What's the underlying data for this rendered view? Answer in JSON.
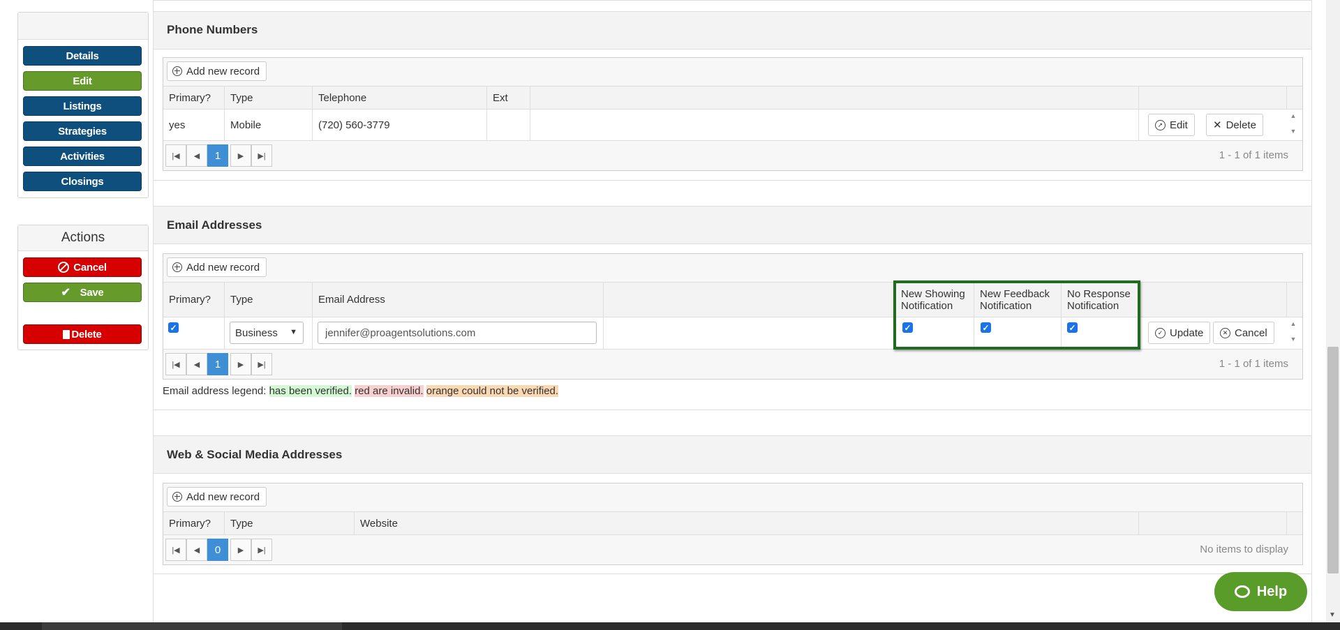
{
  "sidebar": {
    "nav": [
      {
        "label": "Details",
        "color": "#0f4f7d"
      },
      {
        "label": "Edit",
        "color": "#669a2b"
      },
      {
        "label": "Listings",
        "color": "#0f4f7d"
      },
      {
        "label": "Strategies",
        "color": "#0f4f7d"
      },
      {
        "label": "Activities",
        "color": "#0f4f7d"
      },
      {
        "label": "Closings",
        "color": "#0f4f7d"
      }
    ],
    "actions": {
      "title": "Actions",
      "cancel_label": "Cancel",
      "save_label": "Save",
      "delete_label": "Delete"
    }
  },
  "phone": {
    "title": "Phone Numbers",
    "add_label": "Add new record",
    "columns": [
      "Primary?",
      "Type",
      "Telephone",
      "Ext"
    ],
    "rows": [
      {
        "primary": "yes",
        "type": "Mobile",
        "telephone": "(720) 560-3779",
        "ext": ""
      }
    ],
    "edit_label": "Edit",
    "delete_label": "Delete",
    "page": "1",
    "pager_info": "1 - 1 of 1 items"
  },
  "email": {
    "title": "Email Addresses",
    "add_label": "Add new record",
    "columns": [
      "Primary?",
      "Type",
      "Email Address"
    ],
    "notif_columns": [
      "New Showing Notification",
      "New Feedback Notification",
      "No Response Notification"
    ],
    "notif_lines": [
      [
        "New Showing",
        "Notification"
      ],
      [
        "New Feedback",
        "Notification"
      ],
      [
        "No Response",
        "Notification"
      ]
    ],
    "row": {
      "primary_checked": true,
      "type_value": "Business",
      "email_value": "jennifer@proagentsolutions.com",
      "showing_checked": true,
      "feedback_checked": true,
      "noresponse_checked": true
    },
    "update_label": "Update",
    "cancel_label": "Cancel",
    "page": "1",
    "pager_info": "1 - 1 of 1 items",
    "legend_prefix": "Email address legend:",
    "legend_verified": "has been verified.",
    "legend_invalid": "red are invalid.",
    "legend_unverified": "orange could not be verified."
  },
  "web": {
    "title": "Web & Social Media Addresses",
    "add_label": "Add new record",
    "columns": [
      "Primary?",
      "Type",
      "Website"
    ],
    "page": "0",
    "pager_info": "No items to display"
  },
  "help_label": "Help",
  "colors": {
    "navy": "#0f4f7d",
    "green": "#669a2b",
    "red": "#d70000",
    "page_active": "#3f8fd6",
    "highlight": "#1f6b1f"
  }
}
